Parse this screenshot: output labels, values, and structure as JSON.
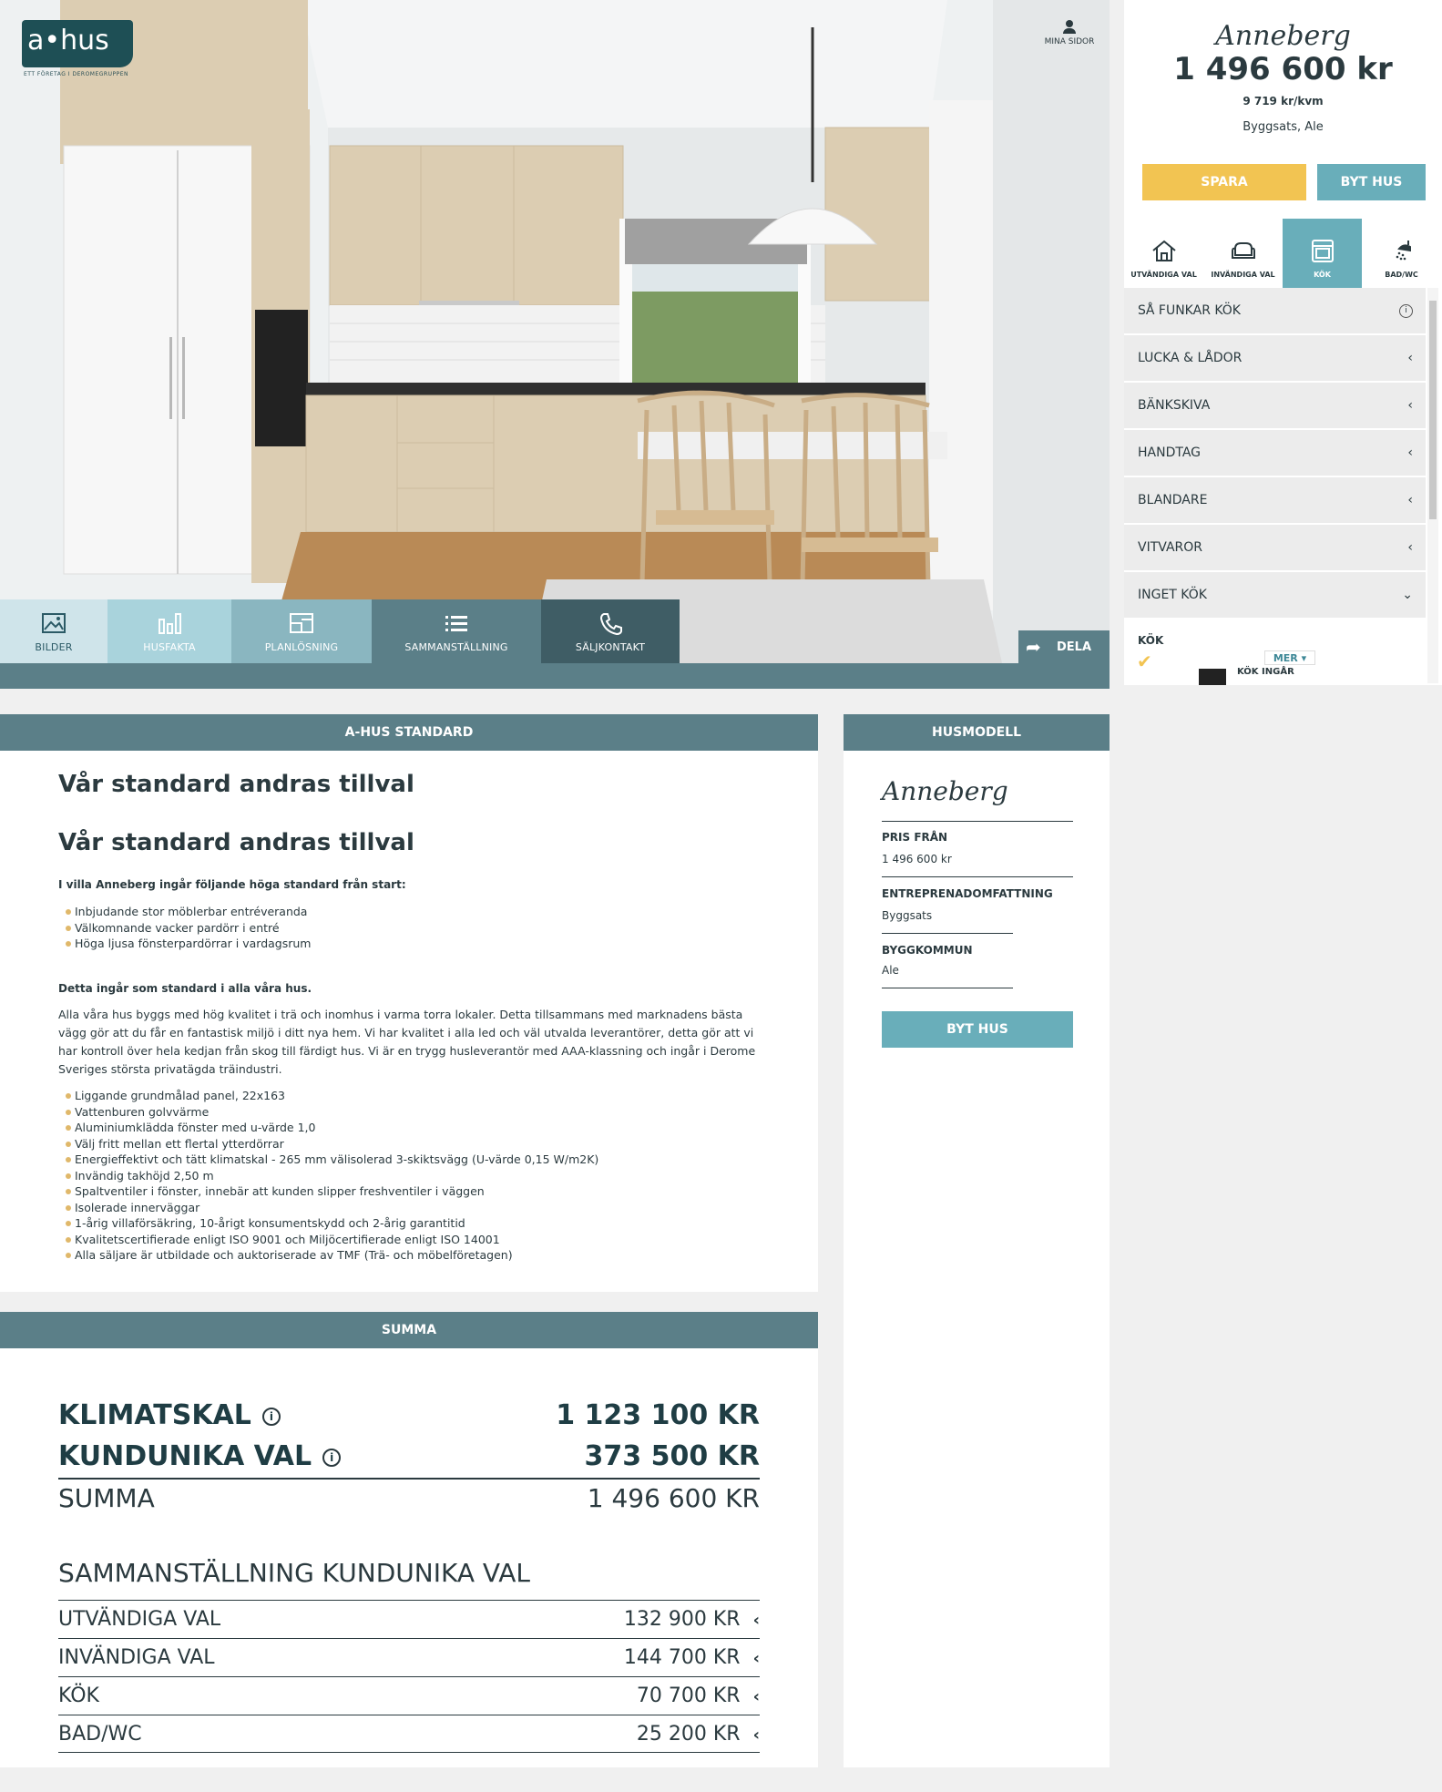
{
  "header": {
    "logo_text": "a•hus",
    "logo_tagline": "ETT FÖRETAG I DEROMEGRUPPEN",
    "mina_sidor": "MINA SIDOR"
  },
  "image_tabs": [
    {
      "label": "BILDER",
      "icon": "image-icon"
    },
    {
      "label": "HUSFAKTA",
      "icon": "bar-chart-icon"
    },
    {
      "label": "PLANLÖSNING",
      "icon": "floorplan-icon"
    },
    {
      "label": "SAMMANSTÄLLNING",
      "icon": "list-icon"
    },
    {
      "label": "SÄLJKONTAKT",
      "icon": "phone-icon"
    }
  ],
  "share": {
    "label": "DELA",
    "icon": "share-arrow-icon"
  },
  "side": {
    "house_name": "Anneberg",
    "price": "1 496 600 kr",
    "price_per_sqm": "9 719 kr/kvm",
    "location": "Byggsats, Ale",
    "save_label": "SPARA",
    "change_house_label": "BYT HUS",
    "categories": [
      {
        "label": "UTVÄNDIGA VAL",
        "icon": "house-icon",
        "active": false
      },
      {
        "label": "INVÄNDIGA VAL",
        "icon": "sofa-icon",
        "active": false
      },
      {
        "label": "KÖK",
        "icon": "oven-icon",
        "active": true
      },
      {
        "label": "BAD/WC",
        "icon": "shower-icon",
        "active": false
      }
    ],
    "menu": [
      {
        "label": "SÅ FUNKAR KÖK",
        "icon": "info-icon"
      },
      {
        "label": "LUCKA & LÅDOR",
        "icon": "chevron-left-icon"
      },
      {
        "label": "BÄNKSKIVA",
        "icon": "chevron-left-icon"
      },
      {
        "label": "HANDTAG",
        "icon": "chevron-left-icon"
      },
      {
        "label": "BLANDARE",
        "icon": "chevron-left-icon"
      },
      {
        "label": "VITVAROR",
        "icon": "chevron-left-icon"
      },
      {
        "label": "INGET KÖK",
        "icon": "chevron-down-icon"
      }
    ],
    "kok_section_title": "KÖK",
    "mer_label": "MER ▾",
    "kok_ingar_label": "KÖK INGÅR"
  },
  "standard": {
    "header": "A-HUS STANDARD",
    "heading1": "Vår standard andras tillval",
    "heading2": "Vår standard andras tillval",
    "intro": "I villa Anneberg ingår följande höga standard från start:",
    "intro_items": [
      "Inbjudande stor möblerbar entréveranda",
      "Välkomnande vacker pardörr i entré",
      "Höga ljusa fönsterpardörrar i vardagsrum"
    ],
    "standard_heading": "Detta ingår som standard i alla våra hus.",
    "standard_text": "Alla våra hus byggs med hög kvalitet i trä och inomhus i varma torra lokaler. Detta tillsammans med marknadens bästa vägg gör att du får en fantastisk miljö i ditt nya hem. Vi har kvalitet i alla led och väl utvalda leverantörer, detta gör att vi har kontroll över hela kedjan från skog till färdigt hus. Vi är en trygg husleverantör med AAA-klassning och ingår i Derome Sveriges största privatägda träindustri.",
    "standard_items": [
      "Liggande grundmålad panel, 22x163",
      "Vattenburen golvvärme",
      "Aluminiumklädda fönster med u-värde 1,0",
      "Välj fritt mellan ett flertal ytterdörrar",
      "Energieffektivt och tätt klimatskal - 265 mm välisolerad 3-skiktsvägg (U-värde 0,15 W/m2K)",
      "Invändig takhöjd 2,50 m",
      "Spaltventiler i fönster, innebär att kunden slipper freshventiler i väggen",
      "Isolerade innerväggar",
      "1-årig villaförsäkring, 10-årigt konsumentskydd och 2-årig garantitid",
      "Kvalitetscertifierade enligt ISO 9001 och Miljöcertifierade enligt ISO 14001",
      "Alla säljare är utbildade och auktoriserade av TMF (Trä- och möbelföretagen)"
    ]
  },
  "husmodell": {
    "header": "HUSMODELL",
    "name": "Anneberg",
    "price_label": "PRIS FRÅN",
    "price_value": "1 496 600 kr",
    "scope_label": "ENTREPRENADOMFATTNING",
    "scope_value": "Byggsats",
    "municipality_label": "BYGGKOMMUN",
    "municipality_value": "Ale",
    "button": "BYT HUS"
  },
  "summa": {
    "header": "SUMMA",
    "rows": [
      {
        "label": "KLIMATSKAL",
        "value": "1 123 100 KR",
        "info": true
      },
      {
        "label": "KUNDUNIKA VAL",
        "value": "373 500 KR",
        "info": true
      }
    ],
    "total_label": "SUMMA",
    "total_value": "1 496 600 KR",
    "breakdown_title": "SAMMANSTÄLLNING KUNDUNIKA VAL",
    "breakdown": [
      {
        "label": "UTVÄNDIGA VAL",
        "value": "132 900 KR"
      },
      {
        "label": "INVÄNDIGA VAL",
        "value": "144 700 KR"
      },
      {
        "label": "KÖK",
        "value": "70 700 KR"
      },
      {
        "label": "BAD/WC",
        "value": "25 200 KR"
      }
    ]
  },
  "colors": {
    "teal_dark": "#5b7f88",
    "teal_light": "#69aeba",
    "yellow": "#f2c452",
    "text": "#2b3a3f"
  }
}
